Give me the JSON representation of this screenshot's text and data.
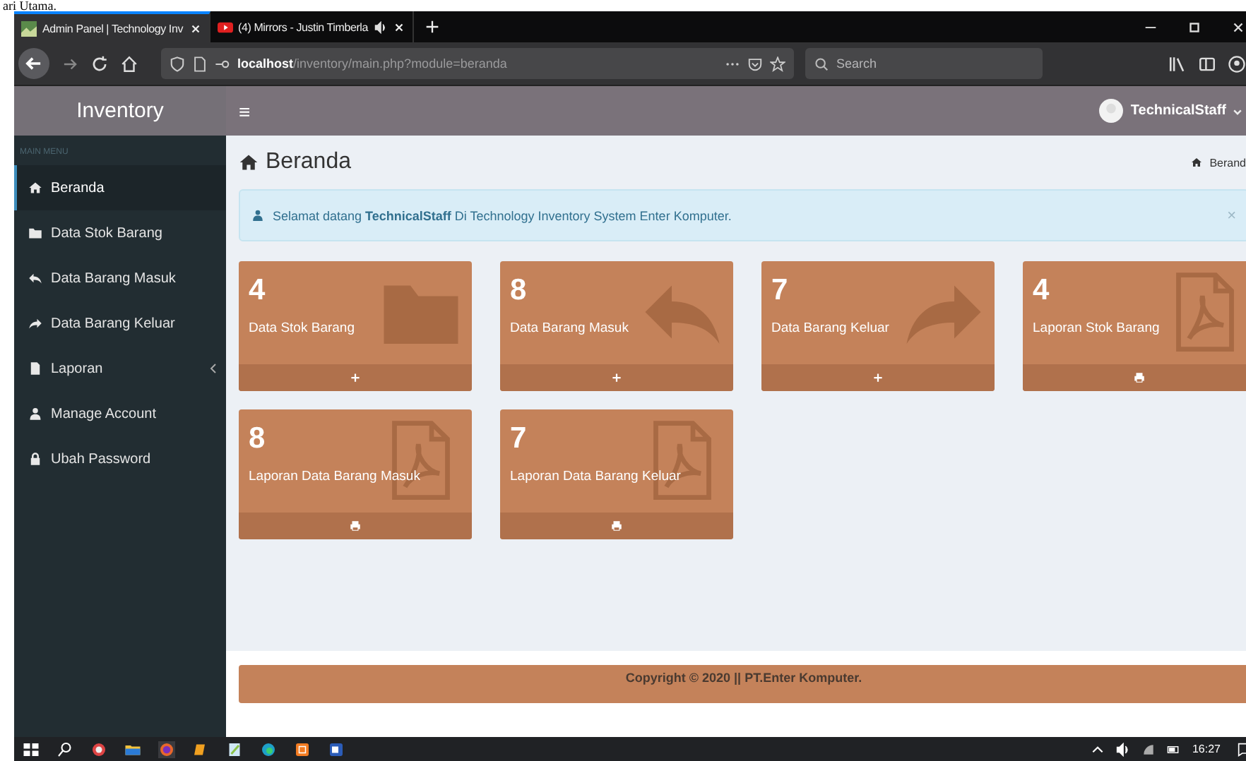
{
  "document_caption": "ari Utama.",
  "browser": {
    "tabs": [
      {
        "title": "Admin Panel | Technology Inv",
        "selected": true,
        "audio": false
      },
      {
        "title": "(4) Mirrors - Justin Timberla",
        "selected": false,
        "audio": true
      }
    ],
    "url_host": "localhost",
    "url_path": "/inventory/main.php?module=beranda",
    "search": {
      "placeholder": "Search"
    }
  },
  "header": {
    "brand": "Inventory",
    "menu_toggle": "≡",
    "user": "TechnicalStaff"
  },
  "sidebar": {
    "heading": "MAIN MENU",
    "items": [
      {
        "label": "Beranda",
        "selected": true,
        "submenu": false
      },
      {
        "label": "Data Stok Barang",
        "selected": false,
        "submenu": false
      },
      {
        "label": "Data Barang Masuk",
        "selected": false,
        "submenu": false
      },
      {
        "label": "Data Barang Keluar",
        "selected": false,
        "submenu": false
      },
      {
        "label": "Laporan",
        "selected": false,
        "submenu": true
      },
      {
        "label": "Manage Account",
        "selected": false,
        "submenu": false
      },
      {
        "label": "Ubah Password",
        "selected": false,
        "submenu": false
      }
    ]
  },
  "page": {
    "title": "Beranda",
    "breadcrumb": "Berand",
    "alert": "Selamat datang **TechnicalStaff** Di Technology Inventory System Enter Komputer.",
    "alert_close": "×"
  },
  "boxes": [
    {
      "count": "4",
      "label": "Data Stok Barang"
    },
    {
      "count": "8",
      "label": "Data Barang Masuk"
    },
    {
      "count": "7",
      "label": "Data Barang Keluar"
    },
    {
      "count": "4",
      "label": "Laporan Stok Barang"
    },
    {
      "count": "8",
      "label": "Laporan Data Barang Masuk"
    },
    {
      "count": "7",
      "label": "Laporan Data Barang Keluar"
    }
  ],
  "footer": "Copyright © 2020 || PT.Enter Komputer.",
  "taskbar": {
    "time": "16:27"
  }
}
